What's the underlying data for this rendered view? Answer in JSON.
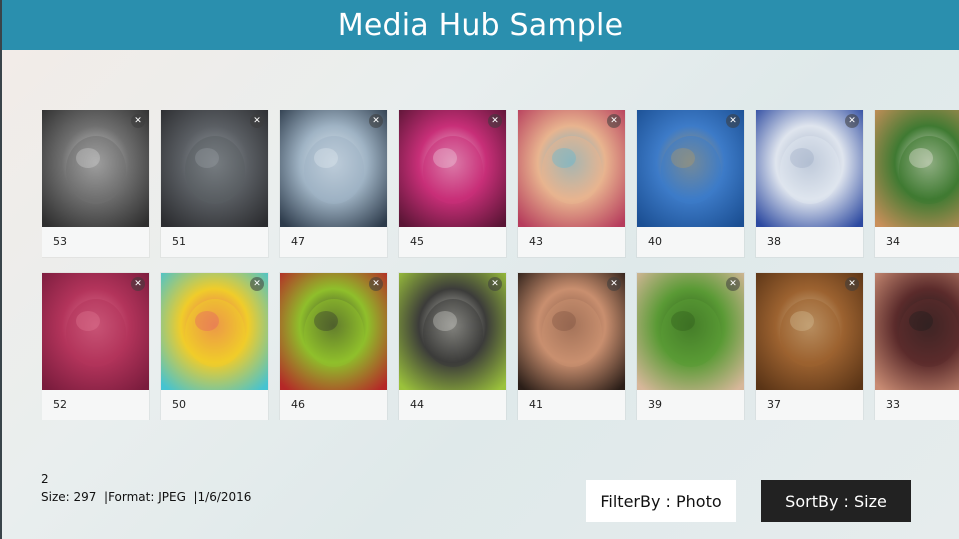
{
  "header": {
    "title": "Media Hub Sample"
  },
  "grid": {
    "rows": [
      [
        {
          "label": "53",
          "image": "grey-cat-photo",
          "colors": [
            "#6f6f6f",
            "#2e2e2e",
            "#d8d8d8"
          ]
        },
        {
          "label": "51",
          "image": "otter-on-rock-photo",
          "colors": [
            "#5a5e63",
            "#2b2c2f",
            "#9aa0a6"
          ]
        },
        {
          "label": "47",
          "image": "glass-elevator-photo",
          "colors": [
            "#9fb3c4",
            "#2d3b4b",
            "#e2ebf2"
          ]
        },
        {
          "label": "45",
          "image": "pink-orchid-photo",
          "colors": [
            "#c82f78",
            "#5a1535",
            "#f2d5e3"
          ]
        },
        {
          "label": "43",
          "image": "face-painted-girl-photo",
          "colors": [
            "#e8b48f",
            "#b63c5c",
            "#5ab6d8"
          ]
        },
        {
          "label": "40",
          "image": "statue-of-liberty-photo",
          "colors": [
            "#3d7bc8",
            "#1b4f93",
            "#b59a63"
          ]
        },
        {
          "label": "38",
          "image": "stock-market-paper-photo",
          "colors": [
            "#dfe5ee",
            "#2c49a0",
            "#9aa9c2"
          ]
        },
        {
          "label": "34",
          "image": "beagle-dog-photo",
          "colors": [
            "#3f7a32",
            "#c98f5a",
            "#f3efe8"
          ]
        }
      ],
      [
        {
          "label": "52",
          "image": "pink-water-drops-photo",
          "colors": [
            "#b3345b",
            "#7a1c3d",
            "#e27a96"
          ]
        },
        {
          "label": "50",
          "image": "rubber-ducks-photo",
          "colors": [
            "#f0cc2a",
            "#45c3d1",
            "#e65a6b"
          ]
        },
        {
          "label": "46",
          "image": "green-door-photo",
          "colors": [
            "#8fbf2b",
            "#b52727",
            "#2d2d2d"
          ]
        },
        {
          "label": "44",
          "image": "print-key-photo",
          "colors": [
            "#3c3c3a",
            "#9bc23b",
            "#d8d8d0"
          ]
        },
        {
          "label": "41",
          "image": "smiling-woman-photo",
          "colors": [
            "#c98f6f",
            "#2b1e18",
            "#7a5140"
          ]
        },
        {
          "label": "39",
          "image": "children-in-grass-photo",
          "colors": [
            "#5a9a35",
            "#d7b79a",
            "#2d5a1b"
          ]
        },
        {
          "label": "37",
          "image": "file-drawers-photo",
          "colors": [
            "#9c6230",
            "#5a3416",
            "#d8c29a"
          ]
        },
        {
          "label": "33",
          "image": "guitar-players-photo",
          "colors": [
            "#5b2b2b",
            "#c88b73",
            "#1d1d1d"
          ]
        }
      ]
    ]
  },
  "info": {
    "count": "2",
    "details": "Size: 297  |Format: JPEG  |1/6/2016"
  },
  "buttons": {
    "filter": "FilterBy : Photo",
    "sort": "SortBy : Size"
  },
  "icons": {
    "badge": "link-icon"
  },
  "colors": {
    "title_bar": "#2a8fae",
    "sort_button": "#222222",
    "filter_button": "#ffffff"
  }
}
